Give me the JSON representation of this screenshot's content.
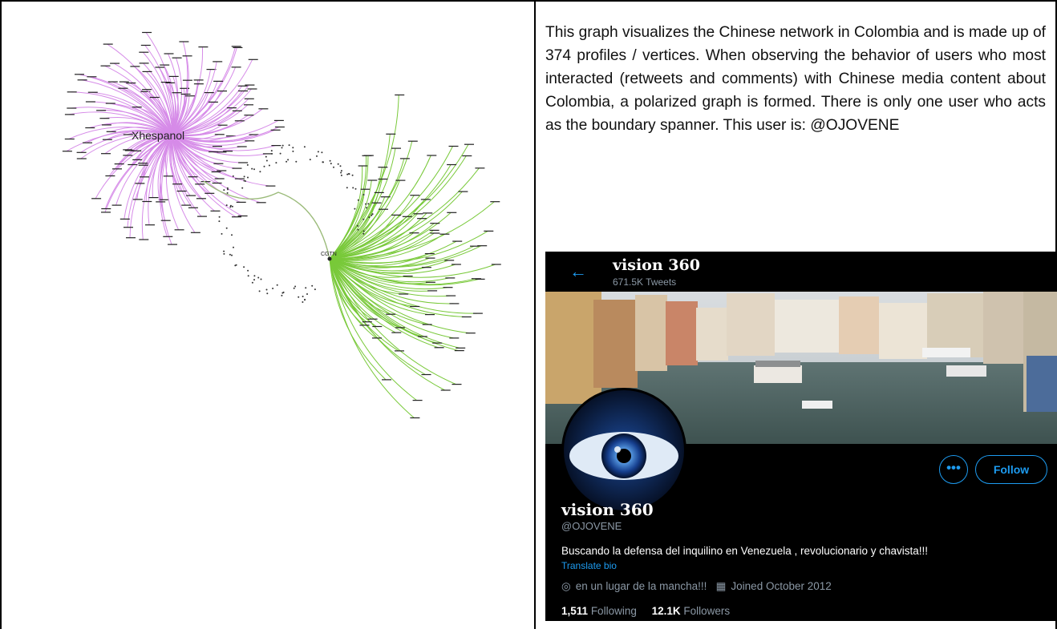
{
  "graph": {
    "hub_left_label": "Xhespanol",
    "hub_right_label": "CGTN",
    "colors": {
      "left": "#d68be8",
      "right": "#79c93a",
      "bridge": "#9bbb7a",
      "dots": "#333333"
    }
  },
  "description": "This graph visualizes the Chinese network in Colombia and is made up of 374 profiles / vertices. When observing the behavior of users who most interacted (retweets and comments) with Chinese media content about Colombia, a polarized graph is formed. There is only one user who acts as the boundary spanner. This user is: @OJOVENE",
  "profile": {
    "back_icon": "arrow-left-icon",
    "header_name": "vision 360",
    "tweets_count": "671.5K Tweets",
    "more_button": "•••",
    "follow_button": "Follow",
    "name": "vision 360",
    "handle": "@OJOVENE",
    "bio": "Buscando la defensa del inquilino en Venezuela , revolucionario y chavista!!!",
    "translate_bio": "Translate bio",
    "location": "en un lugar de la mancha!!!",
    "joined": "Joined October 2012",
    "following_count": "1,511",
    "following_label": "Following",
    "followers_count": "12.1K",
    "followers_label": "Followers",
    "accent_color": "#1d9bf0"
  }
}
